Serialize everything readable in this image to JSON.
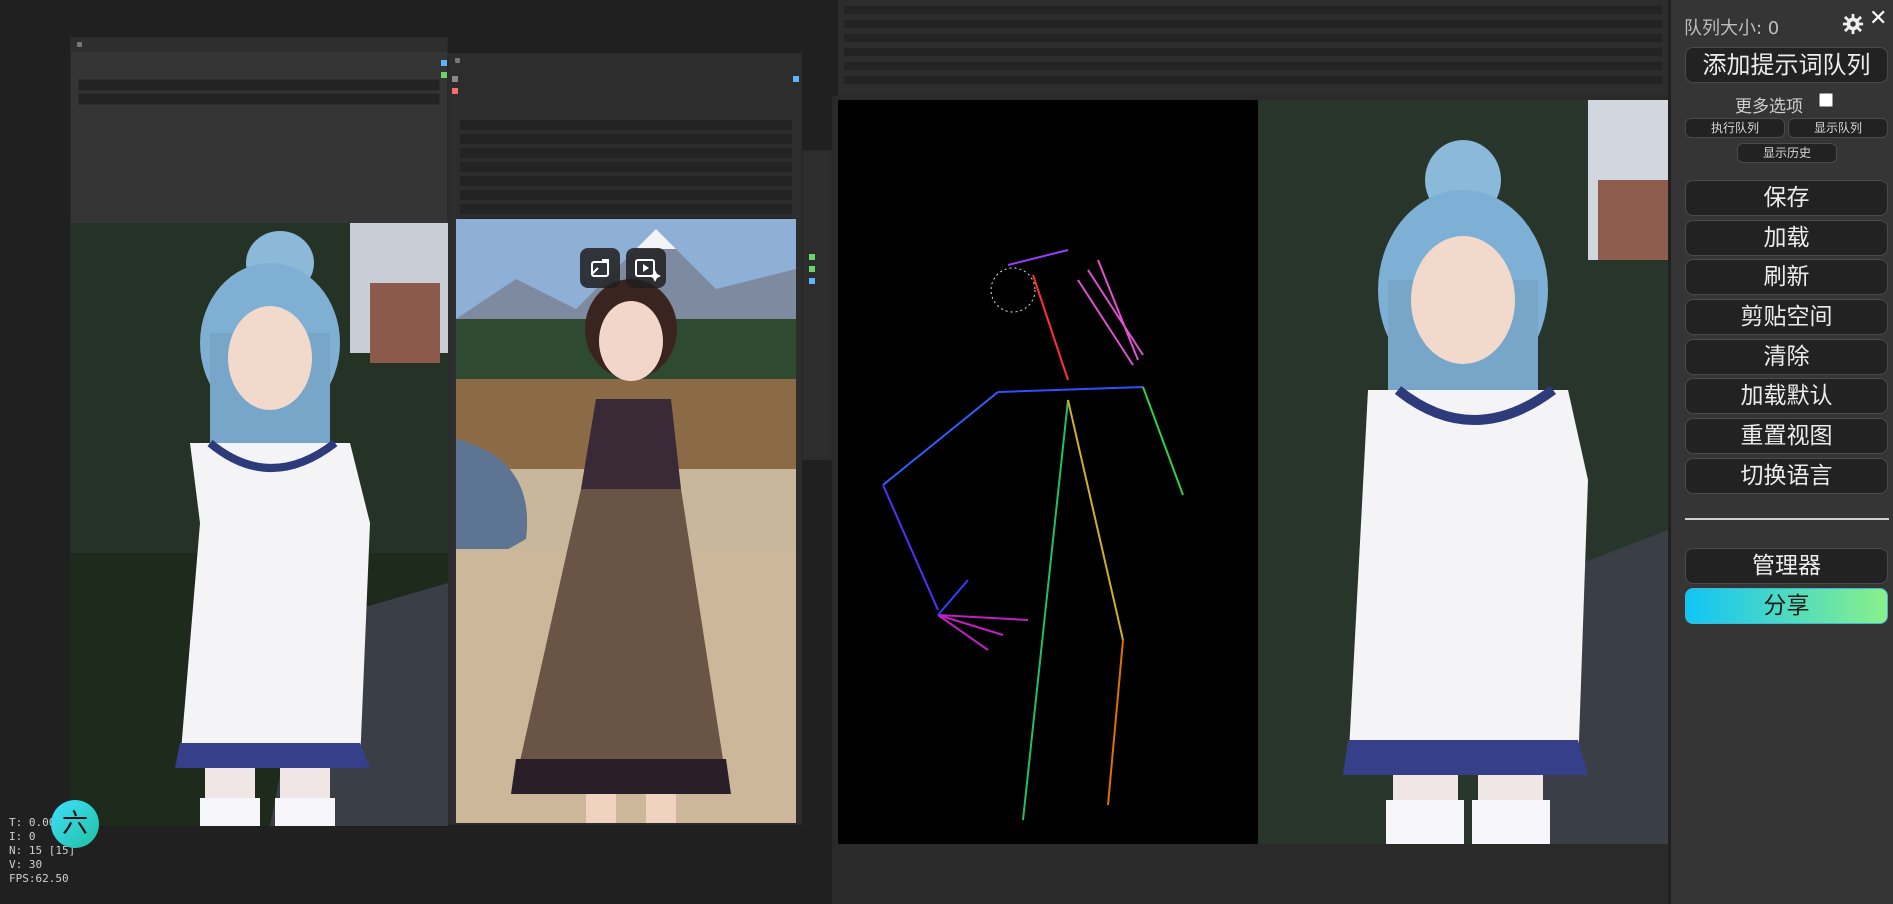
{
  "menu": {
    "queue_size": "队列大小: 0",
    "add_prompt_queue": "添加提示词队列",
    "more_options": "更多选项",
    "run_queue": "执行队列",
    "show_queue": "显示队列",
    "show_history": "显示历史",
    "save": "保存",
    "load": "加载",
    "refresh": "刷新",
    "clipspace": "剪贴空间",
    "clear": "清除",
    "load_default": "加载默认",
    "reset_view": "重置视图",
    "switch_language": "切换语言",
    "manager": "管理器",
    "share": "分享",
    "close": "✕"
  },
  "stats": {
    "t": "T: 0.00s",
    "i": "I: 0",
    "n": "N: 15 [15]",
    "v": "V: 30",
    "fps": "FPS:62.50"
  },
  "logo": {
    "text": "六"
  },
  "icons": {
    "settings": "gear-icon",
    "close": "close-icon",
    "overlay_left": "exit-fullscreen-icon",
    "overlay_right": "play-sparkle-icon"
  },
  "colors": {
    "menu_bg": "#353535",
    "button_bg": "#222222",
    "canvas_bg": "#202020",
    "share_start": "#11c4f7",
    "share_end": "#8af08a"
  }
}
